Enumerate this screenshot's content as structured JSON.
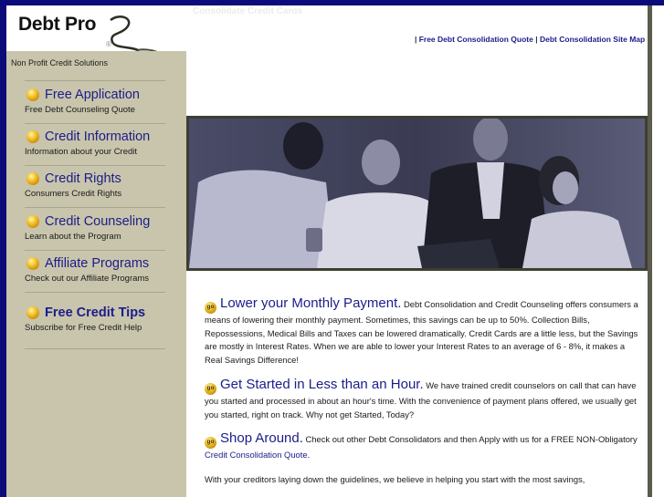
{
  "logo": {
    "name": "Debt Pro",
    "registered_mark": "®",
    "tagline": "Non Profit Credit Solutions"
  },
  "header": {
    "faint_title": "Consolidate Credit Cards",
    "links": [
      {
        "label": "Free Debt Consolidation Quote"
      },
      {
        "label": "Debt Consolidation Site Map"
      }
    ],
    "separator": "|"
  },
  "sidebar": {
    "items": [
      {
        "title": "Free Application",
        "subtitle": "Free Debt Counseling Quote",
        "icon": "gold-bullet-icon"
      },
      {
        "title": "Credit Information",
        "subtitle": "Information about your Credit",
        "icon": "gold-bullet-icon"
      },
      {
        "title": "Credit Rights",
        "subtitle": "Consumers Credit Rights",
        "icon": "gold-bullet-icon"
      },
      {
        "title": "Credit Counseling",
        "subtitle": "Learn about the Program",
        "icon": "gold-bullet-icon"
      },
      {
        "title": "Affiliate Programs",
        "subtitle": "Check out our Affiliate Programs",
        "icon": "gold-bullet-icon"
      },
      {
        "title": "Free Credit Tips",
        "subtitle": "Subscribe for Free Credit Help",
        "icon": "gold-bullet-icon"
      }
    ]
  },
  "hero": {
    "alt": "Four people looking at a computer screen"
  },
  "content": {
    "go_label": "go",
    "sections": [
      {
        "heading": "Lower your Monthly Payment.",
        "body": " Debt Consolidation and Credit Counseling offers consumers a means of lowering their monthly payment.  Sometimes, this savings can be up to 50%. Collection Bills, Repossessions, Medical Bills and Taxes can be lowered dramatically.  Credit Cards are a little less, but the Savings are mostly in Interest Rates.  When we are able to lower your Interest Rates to an average of 6 - 8%, it makes a Real Savings Difference!"
      },
      {
        "heading": "Get Started in Less than an Hour.",
        "body": " We have trained credit counselors on call that can have you started and processed in about an hour's time. With the convenience of payment plans offered, we usually get you started, right on track. Why not get Started, Today?"
      },
      {
        "heading": "Shop Around.",
        "body": " Check out other Debt Consolidators and then Apply with us for a FREE NON-Obligatory ",
        "link": "Credit Consolidation Quote",
        "tail": "."
      }
    ],
    "closing": "With your creditors laying down the guidelines, we believe in helping you start with the most savings,"
  },
  "colors": {
    "frame_border": "#0b0b7a",
    "sidebar_bg": "#c8c5ac",
    "link": "#1c1c8a",
    "right_bar": "#5b5c4c"
  }
}
